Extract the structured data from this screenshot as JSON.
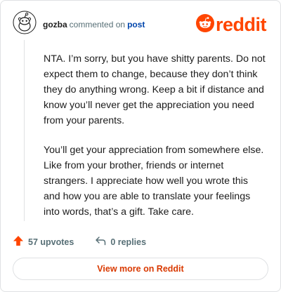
{
  "comment": {
    "username": "gozba",
    "action_text": "commented on",
    "post_link": "post",
    "paragraphs": [
      "NTA. I’m sorry, but you have shitty parents. Do not expect them to change, because they don’t think they do anything wrong. Keep a bit if distance and know you’ll never get the appreciation you need from your parents.",
      "You’ll get your appreciation from somewhere else. Like from your brother, friends or internet strangers. I appreciate how well you wrote this and how you are able to translate your feelings into words, that’s a gift. Take care."
    ],
    "upvotes": "57 upvotes",
    "replies": "0 replies"
  },
  "brand": {
    "wordmark": "reddit",
    "color": "#ff4500"
  },
  "actions": {
    "view_more": "View more on Reddit"
  },
  "icons": {
    "avatar": "snoo-avatar-icon",
    "logo": "reddit-snoo-icon",
    "upvote": "upvote-arrow-icon",
    "reply": "reply-arrow-icon"
  }
}
